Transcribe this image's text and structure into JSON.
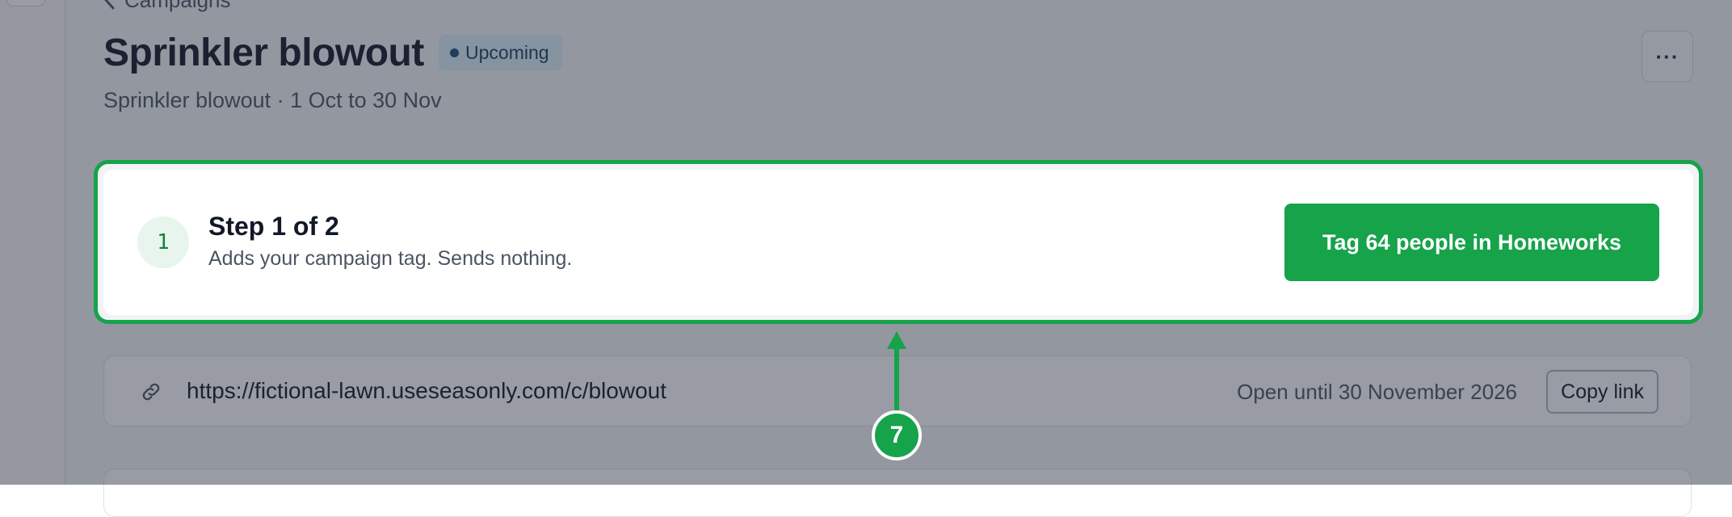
{
  "breadcrumb": {
    "back_label": "Campaigns"
  },
  "header": {
    "title": "Sprinkler blowout",
    "status": "Upcoming",
    "subtitle": "Sprinkler blowout · 1 Oct to 30 Nov",
    "more_label": "···"
  },
  "step": {
    "number": "1",
    "title": "Step 1 of 2",
    "description": "Adds your campaign tag. Sends nothing.",
    "action_label": "Tag 64 people in Homeworks"
  },
  "link": {
    "icon": "link-icon",
    "url": "https://fictional-lawn.useseasonly.com/c/blowout",
    "open_until": "Open until 30 November 2026",
    "copy_label": "Copy link"
  },
  "annotation": {
    "marker": "7"
  },
  "colors": {
    "accent": "#16a34a",
    "badge_bg": "#dbeef8",
    "badge_text": "#16405f"
  }
}
